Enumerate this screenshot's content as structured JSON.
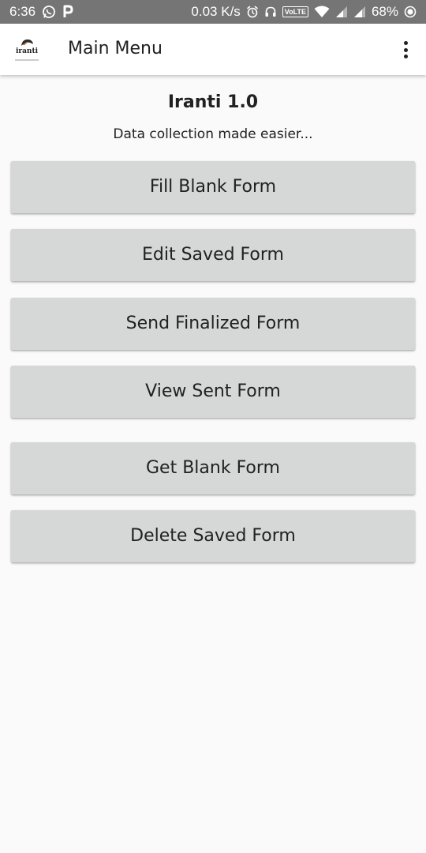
{
  "status_bar": {
    "time": "6:36",
    "network_speed": "0.03 K/s",
    "lte_badge": "VoLTE",
    "battery": "68%",
    "icons": [
      "whatsapp-icon",
      "p-notification-icon",
      "alarm-icon",
      "headphones-icon",
      "wifi-icon",
      "signal-icon",
      "signal-icon",
      "battery-saver-icon"
    ]
  },
  "app_bar": {
    "title": "Main Menu",
    "logo_text": "iranti",
    "menu_icon": "overflow-menu-icon"
  },
  "main": {
    "heading": "Iranti 1.0",
    "tagline": "Data collection made easier...",
    "buttons": [
      {
        "label": "Fill Blank Form"
      },
      {
        "label": "Edit Saved Form"
      },
      {
        "label": "Send Finalized Form"
      },
      {
        "label": "View Sent Form"
      },
      {
        "label": "Get Blank Form"
      },
      {
        "label": "Delete Saved Form"
      }
    ]
  },
  "colors": {
    "status_bar_bg": "#757575",
    "app_bar_bg": "#ffffff",
    "page_bg": "#fafafa",
    "button_bg": "#d6d7d7",
    "text": "#212121"
  }
}
